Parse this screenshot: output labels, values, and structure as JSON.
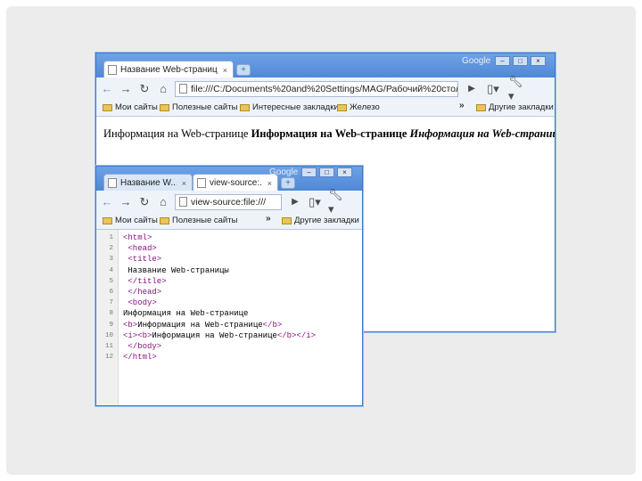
{
  "window1": {
    "tab_label": "Название Web-страницы",
    "tab_close": "×",
    "google": "Google",
    "address": "file:///C:/Documents%20and%20Settings/MAG/Рабочий%20стол",
    "bookmarks": [
      "Мои сайты",
      "Полезные сайты",
      "Интересные закладки",
      "Железо"
    ],
    "overflow": "»",
    "other_bookmarks": "Другие закладки",
    "content": {
      "plain": "Информация на Web-странице",
      "bold": "Информация на Web-странице",
      "bold_italic": "Информация на Web-странице"
    }
  },
  "window2": {
    "tabs": [
      {
        "label": "Название W...",
        "close": "×"
      },
      {
        "label": "view-source:...",
        "close": "×"
      }
    ],
    "google": "Google",
    "address": "view-source:file:///",
    "bookmarks": [
      "Мои сайты",
      "Полезные сайты"
    ],
    "overflow": "»",
    "other_bookmarks": "Другие закладки",
    "source_lines": [
      {
        "n": "1",
        "parts": [
          [
            "tag",
            "<html>"
          ]
        ]
      },
      {
        "n": "2",
        "parts": [
          [
            "tag",
            " <head>"
          ]
        ]
      },
      {
        "n": "3",
        "parts": [
          [
            "tag",
            " <title>"
          ]
        ]
      },
      {
        "n": "4",
        "parts": [
          [
            "text",
            " Название Web-страницы"
          ]
        ]
      },
      {
        "n": "5",
        "parts": [
          [
            "tag",
            " </title>"
          ]
        ]
      },
      {
        "n": "6",
        "parts": [
          [
            "tag",
            " </head>"
          ]
        ]
      },
      {
        "n": "7",
        "parts": [
          [
            "tag",
            " <body>"
          ]
        ]
      },
      {
        "n": "8",
        "parts": [
          [
            "text",
            "Информация на Web-странице"
          ]
        ]
      },
      {
        "n": "9",
        "parts": [
          [
            "tag",
            "<b>"
          ],
          [
            "text",
            "Информация на Web-странице"
          ],
          [
            "tag",
            "</b>"
          ]
        ]
      },
      {
        "n": "10",
        "parts": [
          [
            "tag",
            "<i><b>"
          ],
          [
            "text",
            "Информация на Web-странице"
          ],
          [
            "tag",
            "</b></i>"
          ]
        ]
      },
      {
        "n": "11",
        "parts": [
          [
            "tag",
            " </body>"
          ]
        ]
      },
      {
        "n": "12",
        "parts": [
          [
            "tag",
            "</html>"
          ]
        ]
      }
    ]
  }
}
